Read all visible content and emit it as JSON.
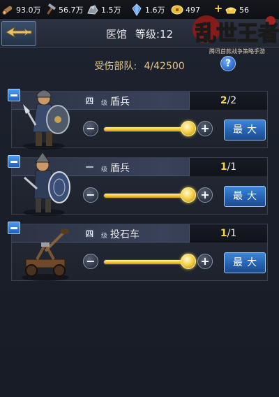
{
  "resources": [
    {
      "icon": "wood-log-icon",
      "value": "93.0万"
    },
    {
      "icon": "hammer-icon",
      "value": "56.7万"
    },
    {
      "icon": "iron-ore-icon",
      "value": "1.5万"
    },
    {
      "icon": "crystal-icon",
      "value": "1.6万"
    },
    {
      "icon": "gold-coin-icon",
      "value": "497"
    },
    {
      "icon": "gold-ingot-icon",
      "value": "56"
    }
  ],
  "logo": {
    "title": "乱世王者",
    "subtitle": "腾讯首款战争策略手游"
  },
  "header": {
    "title": "医馆",
    "level_label": "等级:12"
  },
  "wounded": {
    "label": "受伤部队:",
    "value": "4/42500"
  },
  "help_label": "?",
  "units": [
    {
      "level": "四",
      "level_suffix": "级",
      "name": "盾兵",
      "current": "2",
      "total": "/2",
      "slider_fraction": 1.0,
      "max_label": "最大",
      "minus": "−",
      "plus": "+",
      "portrait": "shield-soldier-portrait-icon"
    },
    {
      "level": "一",
      "level_suffix": "级",
      "name": "盾兵",
      "current": "1",
      "total": "/1",
      "slider_fraction": 1.0,
      "max_label": "最大",
      "minus": "−",
      "plus": "+",
      "portrait": "shield-soldier-portrait-icon"
    },
    {
      "level": "四",
      "level_suffix": "级",
      "name": "投石车",
      "current": "1",
      "total": "/1",
      "slider_fraction": 1.0,
      "max_label": "最大",
      "minus": "−",
      "plus": "+",
      "portrait": "catapult-portrait-icon"
    }
  ],
  "colors": {
    "accent_gold": "#f5d34a",
    "button_blue": "#2762b3",
    "panel": "#242a36"
  }
}
